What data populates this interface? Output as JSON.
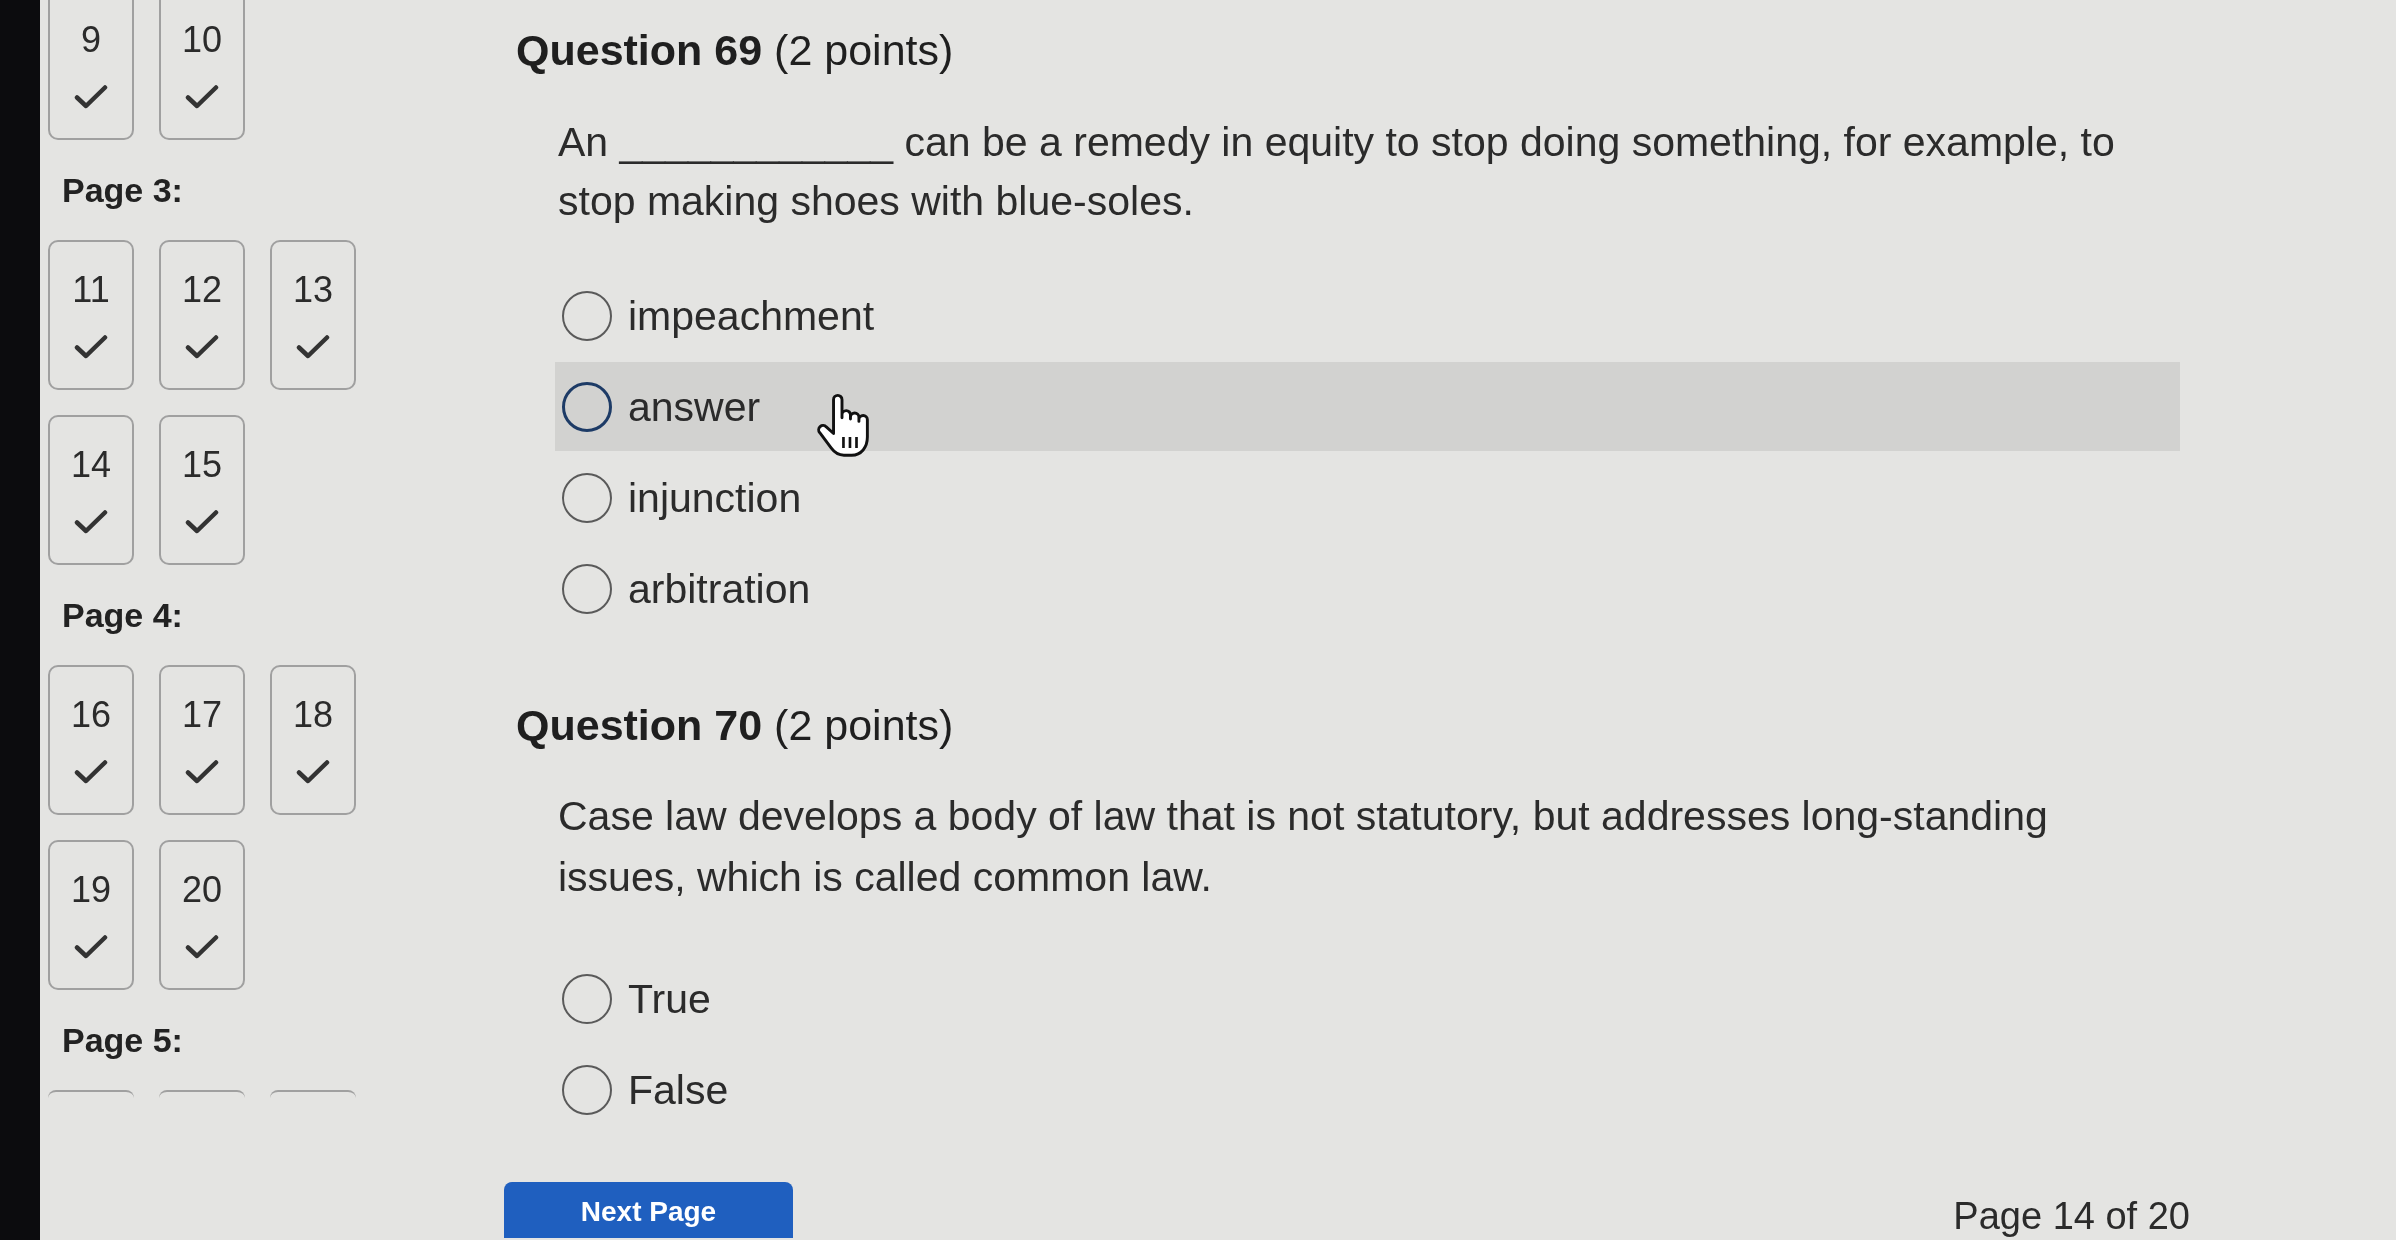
{
  "sidebar": {
    "pages": [
      {
        "questions": [
          {
            "kind": "tile",
            "number": "9",
            "answered": true
          },
          {
            "kind": "tile",
            "number": "10",
            "answered": true
          }
        ]
      },
      {
        "label": "Page 3:",
        "questions": [
          {
            "kind": "tile",
            "number": "11",
            "answered": true
          },
          {
            "kind": "tile",
            "number": "12",
            "answered": true
          },
          {
            "kind": "tile",
            "number": "13",
            "answered": true
          },
          {
            "kind": "tile",
            "number": "14",
            "answered": true
          },
          {
            "kind": "tile",
            "number": "15",
            "answered": true
          }
        ]
      },
      {
        "label": "Page 4:",
        "questions": [
          {
            "kind": "tile",
            "number": "16",
            "answered": true
          },
          {
            "kind": "tile",
            "number": "17",
            "answered": true
          },
          {
            "kind": "tile",
            "number": "18",
            "answered": true
          },
          {
            "kind": "tile",
            "number": "19",
            "answered": true
          },
          {
            "kind": "tile",
            "number": "20",
            "answered": true
          }
        ]
      },
      {
        "label": "Page 5:",
        "questions": [
          {
            "kind": "edge"
          },
          {
            "kind": "edge"
          },
          {
            "kind": "edge"
          }
        ]
      }
    ]
  },
  "questions": [
    {
      "heading": "**Question 69** (2 points)",
      "text": "An ____________ can be a remedy in equity to stop doing something, for example, to stop making shoes with blue-soles.",
      "options": [
        {
          "label": "impeachment",
          "selected": false,
          "hovered": false
        },
        {
          "label": "answer",
          "selected": false,
          "hovered": true
        },
        {
          "label": "injunction",
          "selected": false,
          "hovered": false
        },
        {
          "label": "arbitration",
          "selected": false,
          "hovered": false
        }
      ]
    },
    {
      "heading": "**Question 70** (2 points)",
      "text": "Case law develops a body of law that is not statutory, but addresses long-standing issues, which is called common law.",
      "options": [
        {
          "label": "True",
          "selected": false,
          "hovered": false
        },
        {
          "label": "False",
          "selected": false,
          "hovered": false
        }
      ]
    }
  ],
  "footer": {
    "next_button": "Next Page",
    "page_indicator": "Page 14 of 20"
  }
}
